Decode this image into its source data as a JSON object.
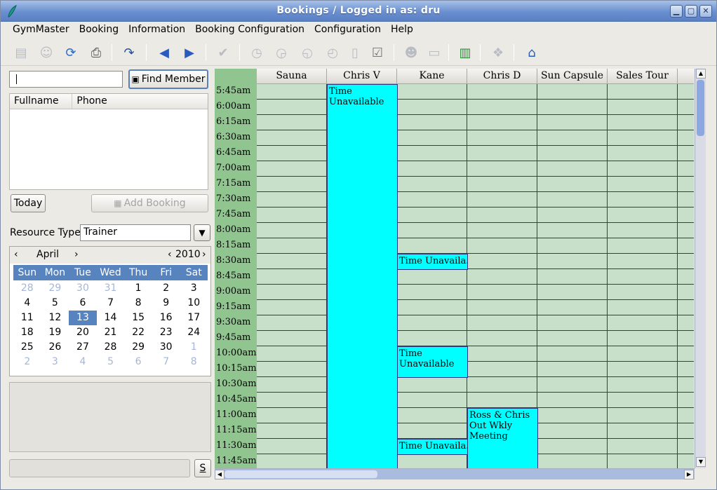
{
  "window": {
    "title": "Bookings / Logged in as: dru",
    "controls": {
      "minimize": "▁",
      "maximize": "▢",
      "close": "✕"
    }
  },
  "menu": [
    "GymMaster",
    "Booking",
    "Information",
    "Booking Configuration",
    "Configuration",
    "Help"
  ],
  "toolbar": {
    "icons": [
      "card-icon",
      "person-icon",
      "refresh-icon",
      "print-icon",
      "redo-icon",
      "back-arrow-icon",
      "forward-arrow-icon",
      "checkmark-icon",
      "clock-icon",
      "clock-back-icon",
      "clock-add-icon",
      "clock-remove-icon",
      "small-card-icon",
      "edit-check-icon",
      "group-icon",
      "card-reader-icon",
      "report-chart-icon",
      "transfer-icon",
      "home-icon"
    ]
  },
  "search": {
    "value": "",
    "find_label": "Find Member"
  },
  "member_list": {
    "columns": [
      "Fullname",
      "Phone"
    ],
    "rows": []
  },
  "buttons": {
    "today": "Today",
    "add_booking": "Add Booking",
    "s": "S"
  },
  "resource_type": {
    "label": "Resource Type",
    "value": "Trainer"
  },
  "calendar": {
    "month": "April",
    "year": "2010",
    "prev": "‹",
    "next": "›",
    "day_names": [
      "Sun",
      "Mon",
      "Tue",
      "Wed",
      "Thu",
      "Fri",
      "Sat"
    ],
    "weeks": [
      [
        "28",
        "29",
        "30",
        "31",
        "1",
        "2",
        "3"
      ],
      [
        "4",
        "5",
        "6",
        "7",
        "8",
        "9",
        "10"
      ],
      [
        "11",
        "12",
        "13",
        "14",
        "15",
        "16",
        "17"
      ],
      [
        "18",
        "19",
        "20",
        "21",
        "22",
        "23",
        "24"
      ],
      [
        "25",
        "26",
        "27",
        "28",
        "29",
        "30",
        "1"
      ],
      [
        "2",
        "3",
        "4",
        "5",
        "6",
        "7",
        "8"
      ]
    ],
    "selected": "13"
  },
  "schedule": {
    "resources": [
      "Sauna",
      "Chris V",
      "Kane",
      "Chris D",
      "Sun Capsule",
      "Sales Tour",
      ""
    ],
    "times": [
      "5:45am",
      "6:00am",
      "6:15am",
      "6:30am",
      "6:45am",
      "7:00am",
      "7:15am",
      "7:30am",
      "7:45am",
      "8:00am",
      "8:15am",
      "8:30am",
      "8:45am",
      "9:00am",
      "9:15am",
      "9:30am",
      "9:45am",
      "10:00am",
      "10:15am",
      "10:30am",
      "10:45am",
      "11:00am",
      "11:15am",
      "11:30am",
      "11:45am"
    ],
    "bookings": [
      {
        "resource": "Chris V",
        "start": "5:45am",
        "slots": 25,
        "text": "Time Unavailable"
      },
      {
        "resource": "Kane",
        "start": "8:30am",
        "slots": 1,
        "text": "Time Unavaila..."
      },
      {
        "resource": "Kane",
        "start": "10:00am",
        "slots": 2,
        "text": "Time Unavailable"
      },
      {
        "resource": "Chris D",
        "start": "11:00am",
        "slots": 4,
        "text": "Ross & Chris Out Wkly Meeting"
      },
      {
        "resource": "Kane",
        "start": "11:30am",
        "slots": 1,
        "text": "Time Unavaila..."
      }
    ]
  }
}
